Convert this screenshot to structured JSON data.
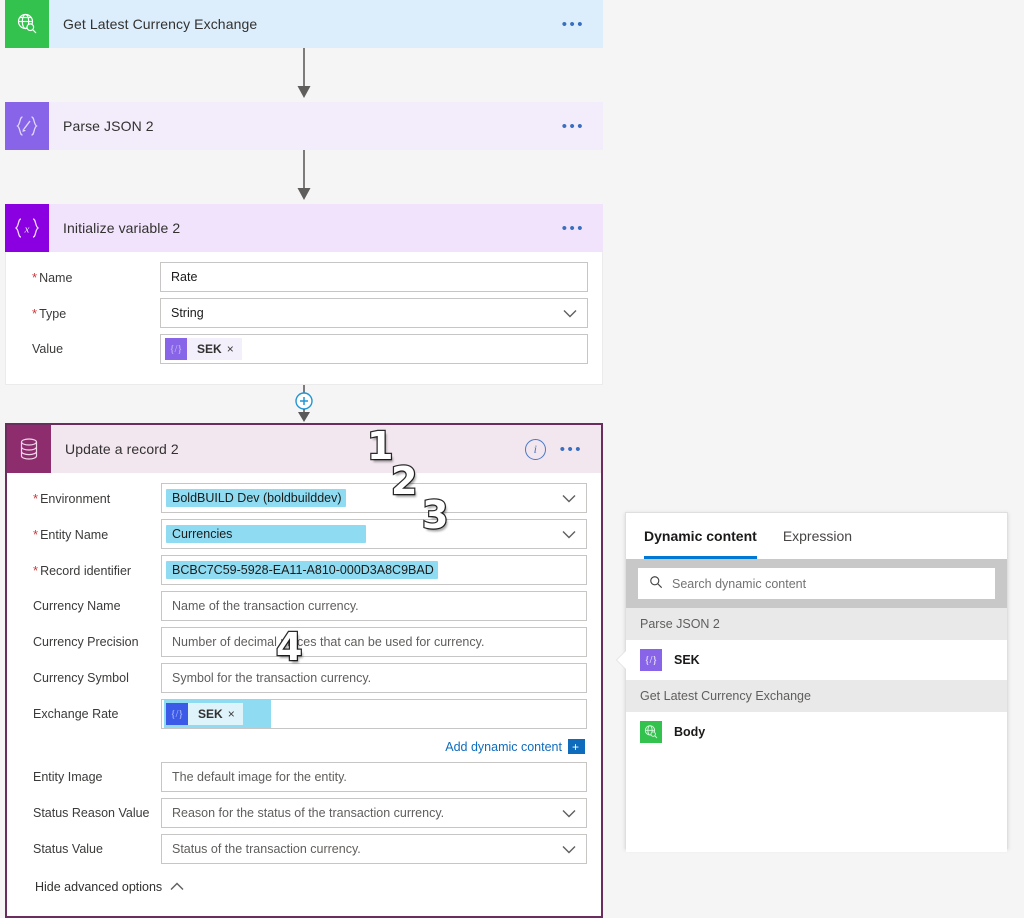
{
  "flow": {
    "cards": [
      {
        "id": "get-latest-currency-exchange",
        "title": "Get Latest Currency Exchange",
        "icon": "globe-search-icon",
        "ellipsis": "•••"
      },
      {
        "id": "parse-json-2",
        "title": "Parse JSON 2",
        "icon": "parse-json-icon",
        "ellipsis": "•••"
      },
      {
        "id": "initialize-variable-2",
        "title": "Initialize variable 2",
        "icon": "variable-icon",
        "ellipsis": "•••"
      }
    ],
    "initialize_variable": {
      "fields": [
        {
          "label": "Name",
          "required": true,
          "value": "Rate",
          "type": "text"
        },
        {
          "label": "Type",
          "required": true,
          "value": "String",
          "type": "select"
        }
      ],
      "value_label": "Value",
      "value_token": {
        "label": "SEK",
        "remove": "×",
        "icon": "expression-token-icon"
      }
    },
    "update_record": {
      "title": "Update a record 2",
      "icon": "database-icon",
      "info_icon": "info-icon",
      "ellipsis": "•••",
      "rows": [
        {
          "label": "Environment",
          "required": true,
          "value": "BoldBUILD Dev (boldbuilddev)",
          "control": "select",
          "highlight": "cyan"
        },
        {
          "label": "Entity Name",
          "required": true,
          "value": "Currencies",
          "control": "select",
          "highlight": "cyan"
        },
        {
          "label": "Record identifier",
          "required": true,
          "value": "BCBC7C59-5928-EA11-A810-000D3A8C9BAD",
          "control": "text",
          "highlight": "cyan"
        },
        {
          "label": "Currency Name",
          "required": false,
          "value": "Name of the transaction currency.",
          "control": "text",
          "highlight": "none",
          "placeholder": true
        },
        {
          "label": "Currency Precision",
          "required": false,
          "value": "Number of decimal places that can be used for currency.",
          "control": "text",
          "highlight": "none",
          "placeholder": true
        },
        {
          "label": "Currency Symbol",
          "required": false,
          "value": "Symbol for the transaction currency.",
          "control": "text",
          "highlight": "none",
          "placeholder": true
        }
      ],
      "exchange_rate": {
        "label": "Exchange Rate",
        "token": {
          "label": "SEK",
          "remove": "×",
          "icon": "expression-token-icon"
        }
      },
      "add_dynamic_content": {
        "label": "Add dynamic content",
        "plus": "+"
      },
      "rows_bottom": [
        {
          "label": "Entity Image",
          "required": false,
          "value": "The default image for the entity.",
          "control": "text",
          "highlight": "none",
          "placeholder": true
        },
        {
          "label": "Status Reason Value",
          "required": false,
          "value": "Reason for the status of the transaction currency.",
          "control": "select",
          "highlight": "none",
          "placeholder": true
        },
        {
          "label": "Status Value",
          "required": false,
          "value": "Status of the transaction currency.",
          "control": "select",
          "highlight": "none",
          "placeholder": true
        }
      ],
      "hide_advanced": {
        "label": "Hide advanced options",
        "icon": "chevron-up-icon"
      }
    }
  },
  "annotations": [
    {
      "id": "annotation-1",
      "text": "1"
    },
    {
      "id": "annotation-2",
      "text": "2"
    },
    {
      "id": "annotation-3",
      "text": "3"
    },
    {
      "id": "annotation-4",
      "text": "4"
    }
  ],
  "dynamic_panel": {
    "tabs": [
      {
        "label": "Dynamic content",
        "active": true
      },
      {
        "label": "Expression",
        "active": false
      }
    ],
    "search": {
      "placeholder": "Search dynamic content",
      "icon": "search-icon",
      "value": ""
    },
    "groups": [
      {
        "title": "Parse JSON 2",
        "items": [
          {
            "label": "SEK",
            "icon": "expression-token-icon",
            "color": "violet"
          }
        ]
      },
      {
        "title": "Get Latest Currency Exchange",
        "items": [
          {
            "label": "Body",
            "icon": "globe-search-icon",
            "color": "green"
          }
        ]
      }
    ]
  },
  "colors": {
    "accent_blue": "#0078d4",
    "link_blue": "#0f6cbd",
    "highlight_cyan": "#8fdcf2",
    "green": "#32c24d",
    "violet": "#8764e8",
    "purple": "#8a00e0",
    "plum": "#8e2d6e",
    "required_red": "#d13438"
  }
}
